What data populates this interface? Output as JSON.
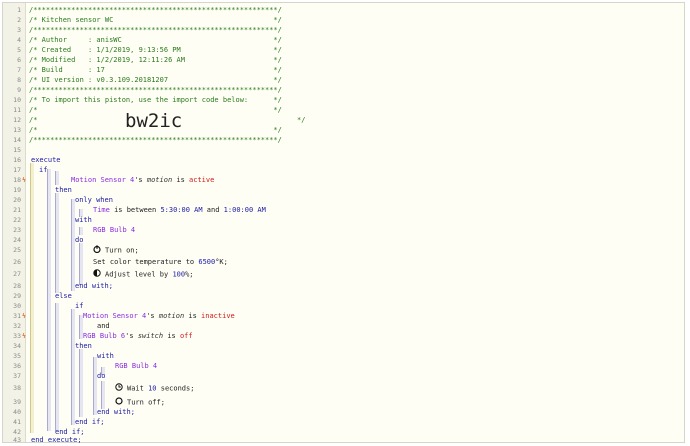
{
  "lines": [
    {
      "n": "1",
      "text": "/**********************************************************/"
    },
    {
      "n": "2",
      "text": "/* Kitchen sensor WC                                      */"
    },
    {
      "n": "3",
      "text": "/**********************************************************/"
    },
    {
      "n": "4",
      "text": "/* Author     : anisWC                                    */"
    },
    {
      "n": "5",
      "text": "/* Created    : 1/1/2019, 9:13:56 PM                      */"
    },
    {
      "n": "6",
      "text": "/* Modified   : 1/2/2019, 12:11:26 AM                     */"
    },
    {
      "n": "7",
      "text": "/* Build      : 17                                        */"
    },
    {
      "n": "8",
      "text": "/* UI version : v0.3.109.20181207                         */"
    },
    {
      "n": "9",
      "text": "/**********************************************************/"
    },
    {
      "n": "10",
      "text": "/* To import this piston, use the import code below:      */"
    },
    {
      "n": "11",
      "text": "/*                                                        */"
    },
    {
      "n": "12a",
      "text": "/*"
    },
    {
      "n": "12b",
      "text": "*/"
    },
    {
      "n": "13",
      "text": "/*                                                        */"
    },
    {
      "n": "14",
      "text": "/**********************************************************/"
    }
  ],
  "import_code": "bw2ic",
  "gutter_numbers": [
    "1",
    "2",
    "3",
    "4",
    "5",
    "6",
    "7",
    "8",
    "9",
    "10",
    "11",
    "12",
    "13",
    "14",
    "15",
    "16",
    "17",
    "18",
    "19",
    "20",
    "21",
    "22",
    "23",
    "24",
    "25",
    "26",
    "27",
    "28",
    "29",
    "30",
    "31",
    "32",
    "33",
    "34",
    "35",
    "36",
    "37",
    "38",
    "39",
    "40",
    "41",
    "42",
    "43"
  ],
  "markers": {
    "m18": "ϟ",
    "m31": "ϟ",
    "m33": "ϟ"
  },
  "code": {
    "execute": "execute",
    "if": "if",
    "motion1_dev": "Motion Sensor 4",
    "motion1_mid": "'s ",
    "motion1_attr": "motion",
    "motion1_is": " is ",
    "motion1_val": "active",
    "then": "then",
    "only_when": "only when",
    "time_a": "Time",
    "time_b": " is between ",
    "time_c": "5:30:00 AM",
    "time_d": " and ",
    "time_e": "1:00:00 AM",
    "with": "with",
    "rgb4": "RGB Bulb 4",
    "do": "do",
    "turn_on": "Turn on;",
    "set_color_a": "Set color temperature to ",
    "set_color_b": "6500",
    "set_color_c": "°K;",
    "adjust_a": "Adjust level by ",
    "adjust_b": "100",
    "adjust_c": "%;",
    "end_with": "end with;",
    "else": "else",
    "if2": "if",
    "motion2_dev": "Motion Sensor 4",
    "motion2_mid": "'s ",
    "motion2_attr": "motion",
    "motion2_is": " is ",
    "motion2_val": "inactive",
    "and": "and",
    "rgb6_dev": "RGB Bulb 6",
    "rgb6_mid": "'s ",
    "rgb6_attr": "switch",
    "rgb6_is": " is ",
    "rgb6_val": "off",
    "then2": "then",
    "with2": "with",
    "rgb4b": "RGB Bulb 4",
    "do2": "do",
    "wait_a": "Wait ",
    "wait_b": "10",
    "wait_c": " seconds;",
    "turn_off": "Turn off;",
    "end_with2": "end with;",
    "end_if_inner": "end if;",
    "end_if": "end if;",
    "end_execute": "end execute;"
  }
}
